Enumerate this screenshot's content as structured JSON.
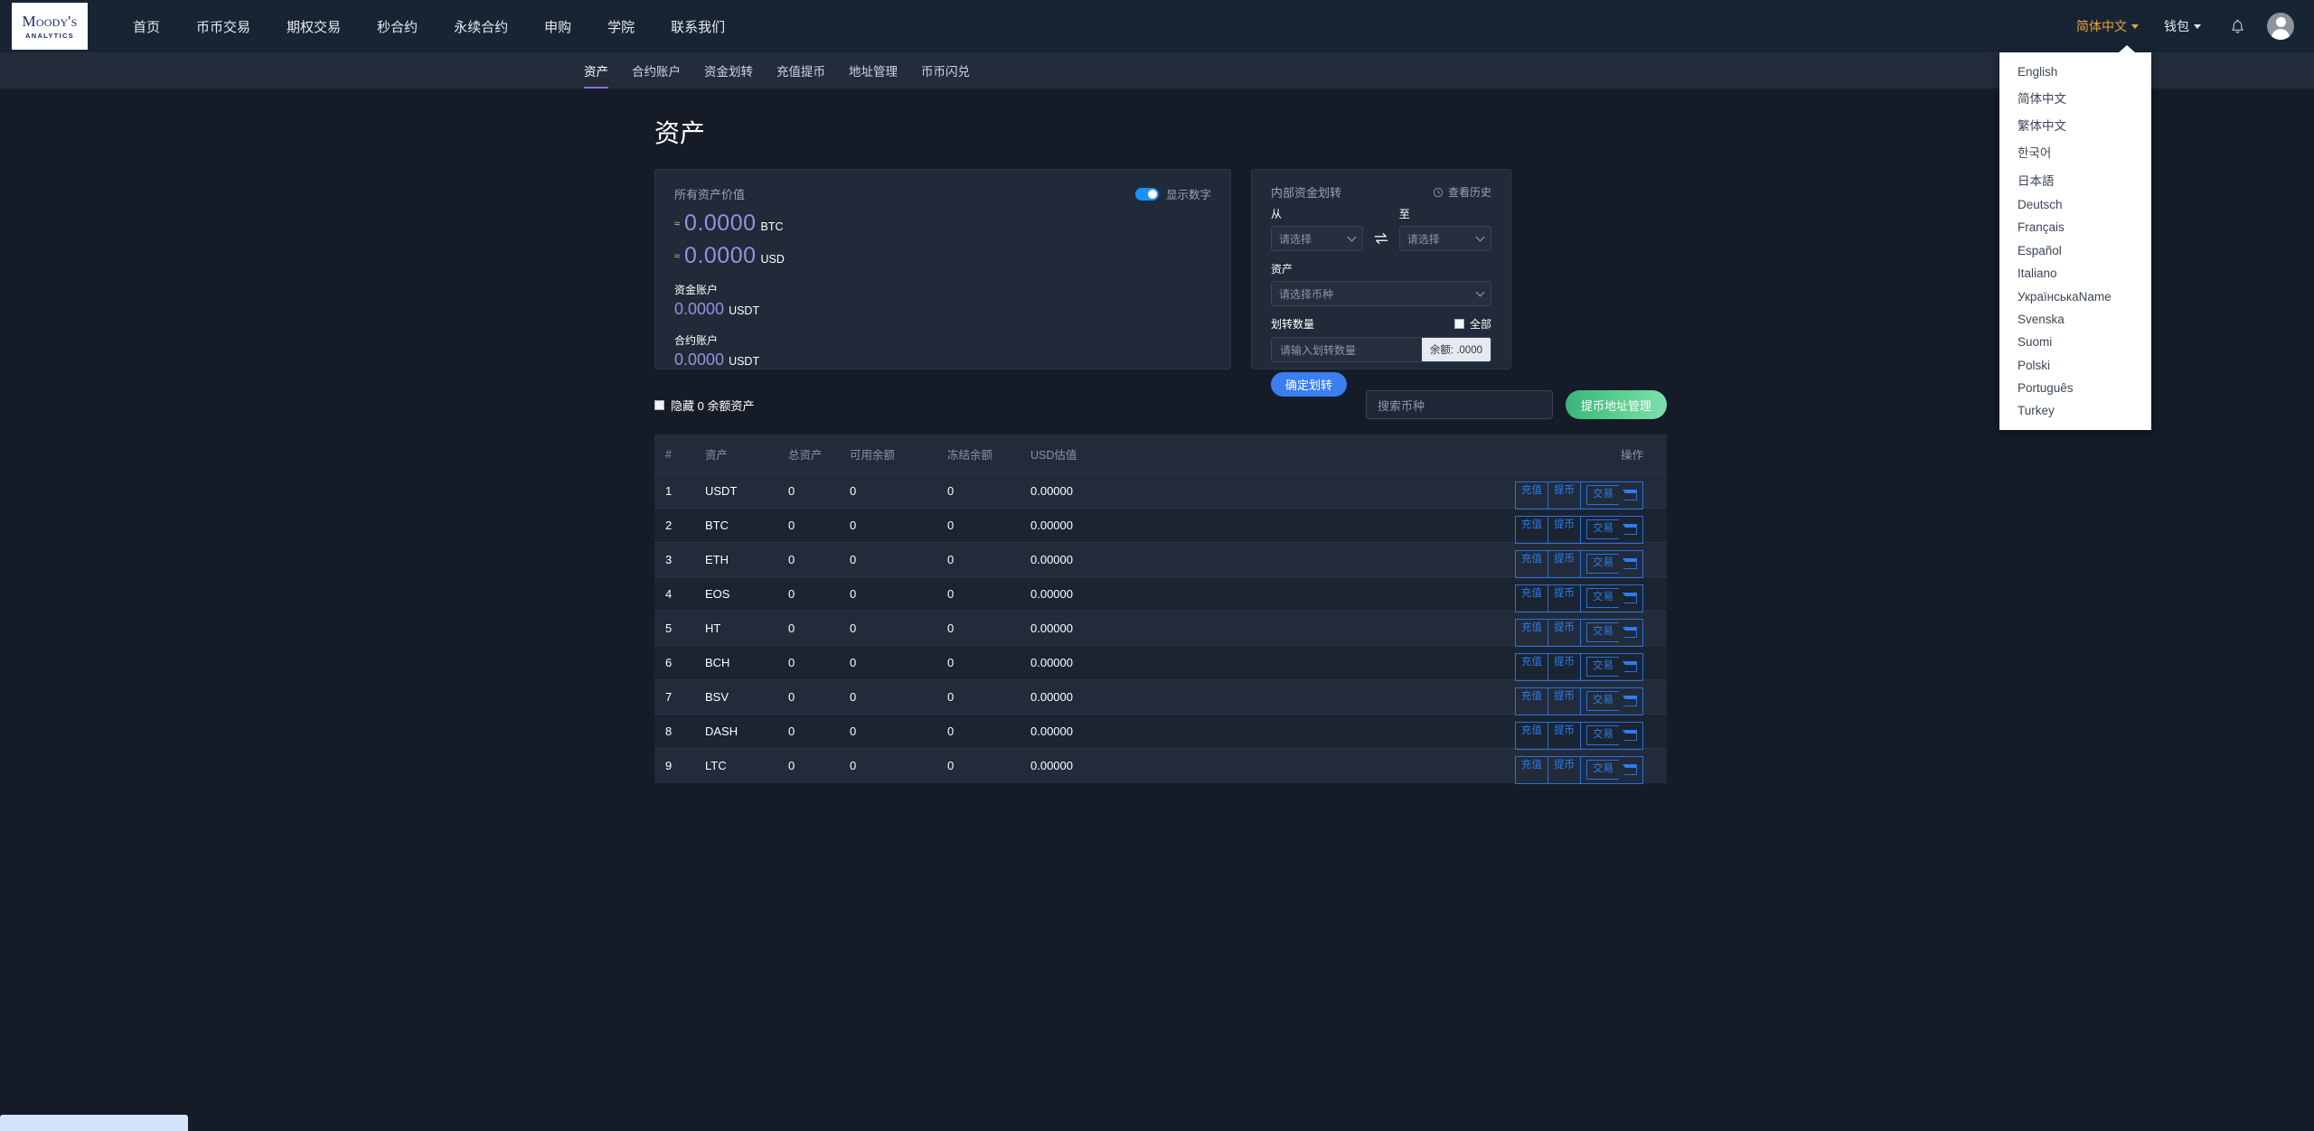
{
  "brand": {
    "name": "Moody's",
    "sub": "ANALYTICS"
  },
  "topnav": {
    "links": [
      {
        "label": "首页"
      },
      {
        "label": "币币交易"
      },
      {
        "label": "期权交易"
      },
      {
        "label": "秒合约"
      },
      {
        "label": "永续合约"
      },
      {
        "label": "申购"
      },
      {
        "label": "学院"
      },
      {
        "label": "联系我们"
      }
    ],
    "language_selected": "简体中文",
    "wallet_label": "钱包",
    "bell_icon": "bell-icon",
    "avatar_icon": "avatar-icon",
    "accent_lang_color": "#e8a33d"
  },
  "language_menu": {
    "items": [
      "English",
      "简体中文",
      "繁体中文",
      "한국어",
      "日本語",
      "Deutsch",
      "Français",
      "Español",
      "Italiano",
      "УкраїнськаName",
      "Svenska",
      "Suomi",
      "Polski",
      "Português",
      "Turkey"
    ]
  },
  "subnav": {
    "items": [
      {
        "label": "资产",
        "active": true
      },
      {
        "label": "合约账户",
        "active": false
      },
      {
        "label": "资金划转",
        "active": false
      },
      {
        "label": "充值提币",
        "active": false
      },
      {
        "label": "地址管理",
        "active": false
      },
      {
        "label": "币币闪兑",
        "active": false
      }
    ],
    "active_underline_color": "#8d6fd1"
  },
  "page": {
    "title": "资产"
  },
  "assets_card": {
    "title": "所有资产价值",
    "toggle_label": "显示数字",
    "toggle_on": true,
    "toggle_color": "#1890ff",
    "approx_symbol": "≈",
    "btc_value": "0.0000",
    "btc_unit": "BTC",
    "usd_value": "0.0000",
    "usd_unit": "USD",
    "fund_account_label": "资金账户",
    "fund_account_value": "0.0000",
    "fund_account_unit": "USDT",
    "contract_account_label": "合约账户",
    "contract_account_value": "0.0000",
    "contract_account_unit": "USDT",
    "value_color": "#9b8ede"
  },
  "transfer_card": {
    "title": "内部资金划转",
    "history_label": "查看历史",
    "history_icon": "clock-icon",
    "from_label": "从",
    "from_placeholder": "请选择",
    "to_label": "至",
    "to_placeholder": "请选择",
    "swap_icon": "swap-arrows-icon",
    "asset_label": "资产",
    "asset_placeholder": "请选择币种",
    "amount_label": "划转数量",
    "all_label": "全部",
    "all_checked": false,
    "amount_placeholder": "请输入划转数量",
    "balance_suffix": "余额: .0000",
    "confirm_label": "确定划转",
    "confirm_color": "#3b7ef0"
  },
  "filter": {
    "hide_zero_label": "隐藏 0 余额资产",
    "hide_zero_checked": false,
    "search_placeholder": "搜索币种",
    "withdraw_address_label": "提币地址管理",
    "withdraw_button_color": "#5fd194"
  },
  "table": {
    "columns": [
      "#",
      "资产",
      "总资产",
      "可用余额",
      "冻结余额",
      "USD估值",
      "操作"
    ],
    "action_labels": {
      "deposit": "充值",
      "withdraw": "提币",
      "trade": "交易"
    },
    "rows": [
      {
        "idx": "1",
        "asset": "USDT",
        "total": "0",
        "available": "0",
        "frozen": "0",
        "usd": "0.00000"
      },
      {
        "idx": "2",
        "asset": "BTC",
        "total": "0",
        "available": "0",
        "frozen": "0",
        "usd": "0.00000"
      },
      {
        "idx": "3",
        "asset": "ETH",
        "total": "0",
        "available": "0",
        "frozen": "0",
        "usd": "0.00000"
      },
      {
        "idx": "4",
        "asset": "EOS",
        "total": "0",
        "available": "0",
        "frozen": "0",
        "usd": "0.00000"
      },
      {
        "idx": "5",
        "asset": "HT",
        "total": "0",
        "available": "0",
        "frozen": "0",
        "usd": "0.00000"
      },
      {
        "idx": "6",
        "asset": "BCH",
        "total": "0",
        "available": "0",
        "frozen": "0",
        "usd": "0.00000"
      },
      {
        "idx": "7",
        "asset": "BSV",
        "total": "0",
        "available": "0",
        "frozen": "0",
        "usd": "0.00000"
      },
      {
        "idx": "8",
        "asset": "DASH",
        "total": "0",
        "available": "0",
        "frozen": "0",
        "usd": "0.00000"
      },
      {
        "idx": "9",
        "asset": "LTC",
        "total": "0",
        "available": "0",
        "frozen": "0",
        "usd": "0.00000"
      }
    ]
  }
}
